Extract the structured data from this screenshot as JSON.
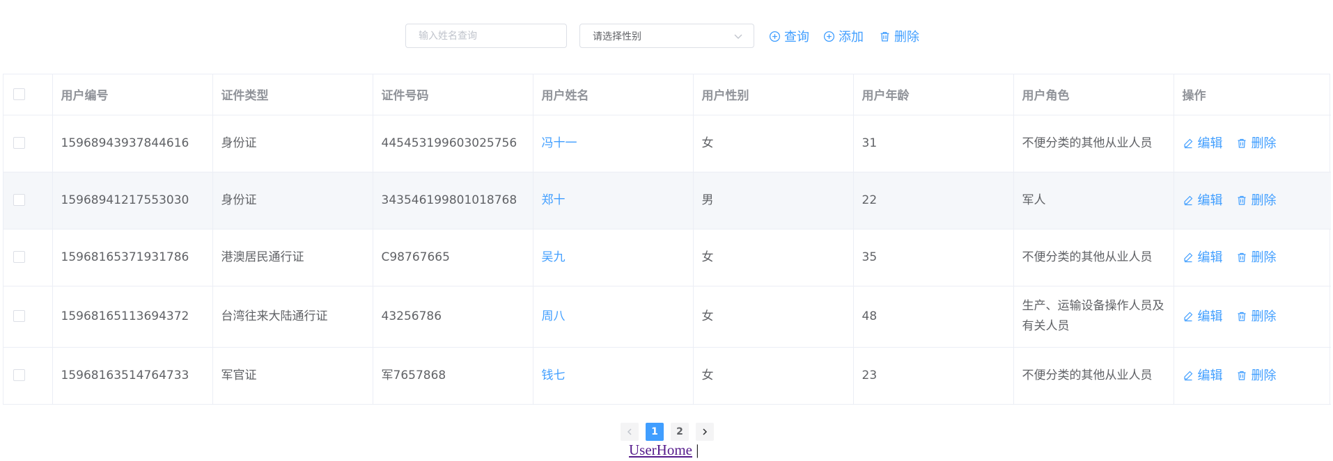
{
  "toolbar": {
    "search_placeholder": "输入姓名查询",
    "gender_placeholder": "请选择性别",
    "query_label": "查询",
    "add_label": "添加",
    "delete_label": "删除"
  },
  "table": {
    "headers": [
      "用户编号",
      "证件类型",
      "证件号码",
      "用户姓名",
      "用户性别",
      "用户年龄",
      "用户角色",
      "操作"
    ],
    "rows": [
      {
        "id": "15968943937844616",
        "id_type": "身份证",
        "id_number": "445453199603025756",
        "name": "冯十一",
        "gender": "女",
        "age": "31",
        "role": "不便分类的其他从业人员"
      },
      {
        "id": "15968941217553030",
        "id_type": "身份证",
        "id_number": "343546199801018768",
        "name": "郑十",
        "gender": "男",
        "age": "22",
        "role": "军人"
      },
      {
        "id": "15968165371931786",
        "id_type": "港澳居民通行证",
        "id_number": "C98767665",
        "name": "吴九",
        "gender": "女",
        "age": "35",
        "role": "不便分类的其他从业人员"
      },
      {
        "id": "15968165113694372",
        "id_type": "台湾往来大陆通行证",
        "id_number": "43256786",
        "name": "周八",
        "gender": "女",
        "age": "48",
        "role": "生产、运输设备操作人员及有关人员"
      },
      {
        "id": "15968163514764733",
        "id_type": "军官证",
        "id_number": "军7657868",
        "name": "钱七",
        "gender": "女",
        "age": "23",
        "role": "不便分类的其他从业人员"
      }
    ],
    "edit_label": "编辑",
    "delete_label": "删除"
  },
  "pagination": {
    "pages": [
      "1",
      "2"
    ],
    "current": "1"
  },
  "footer": {
    "link": "UserHome",
    "separator": " |"
  },
  "colors": {
    "accent": "#409eff",
    "text": "#606266",
    "header_text": "#909399",
    "border": "#ebeef5",
    "stripe": "#f5f7fa"
  },
  "icons": {
    "query": "circle-plus-icon",
    "add": "circle-plus-icon",
    "delete": "trash-icon",
    "edit": "pencil-icon",
    "select": "chevron-down-icon",
    "prev": "chevron-left-icon",
    "next": "chevron-right-icon"
  }
}
